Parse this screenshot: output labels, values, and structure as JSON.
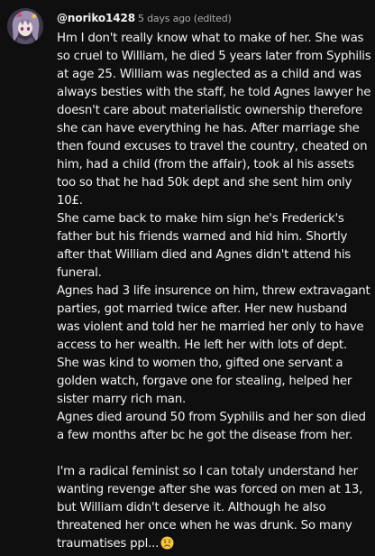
{
  "comment": {
    "author": "@noriko1428",
    "timestamp": "5 days ago (edited)",
    "avatar_icon": "anime-character-avatar",
    "paragraphs": [
      "Hm I don't really know what to make of her. She was so cruel to William, he died 5 years later from Syphilis at age 25. William was neglected as a child and was always besties with the staff, he told Agnes lawyer he doesn't care about materialistic ownership therefore she can have everything he has. After marriage she then found excuses to travel the country, cheated on him, had a child (from the affair), took al his assets too so that he had 50k dept and she sent him only  10£.\nShe came back to make him sign he's Frederick's father but his friends warned and hid him. Shortly after that William died and Agnes didn't attend his funeral.\nAgnes had 3 life insurence on him, threw extravagant parties, got married twice after. Her new  husband was violent and told her he married her only to have access to her wealth. He left her with lots of dept.\nShe was kind to women tho, gifted one servant a golden watch, forgave one for stealing, helped her sister marry rich man.\nAgnes died around 50 from Syphilis and her son died a few months after bc he got the disease from her.",
      "I'm a radical feminist so I can totaly understand her wanting revenge after she was forced on men at 13, but William didn't deserve it. Although he also threatened her once when he was drunk. So many traumatises ppl..."
    ],
    "emoji_icon": "worried-face-emoji"
  }
}
